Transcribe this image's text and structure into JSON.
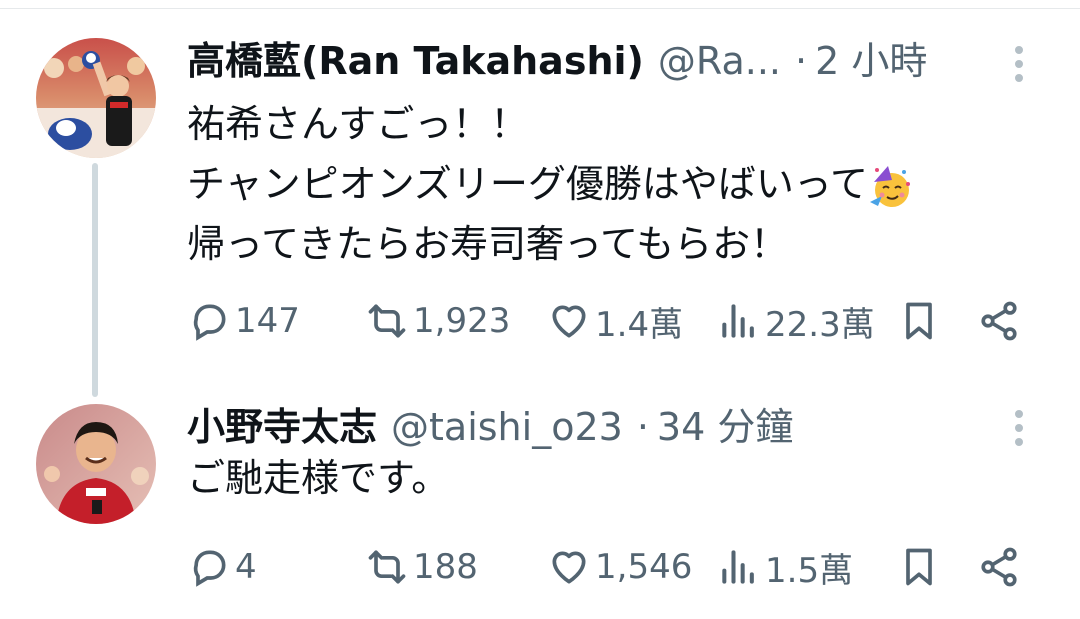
{
  "tweets": [
    {
      "name": "高橋藍(Ran Takahashi)",
      "handle": "@Ra...",
      "separator": "·",
      "time": "2 小時",
      "lines": [
        "祐希さんすごっ！！",
        "チャンピオンズリーグ優勝はやばいって",
        "帰ってきたらお寿司奢ってもらお！"
      ],
      "emoji": "partying-face",
      "replies": "147",
      "retweets": "1,923",
      "likes": "1.4萬",
      "views": "22.3萬"
    },
    {
      "name": "小野寺太志",
      "handle": "@taishi_o23",
      "separator": "·",
      "time": "34 分鐘",
      "lines": [
        "ご馳走様です。"
      ],
      "replies": "4",
      "retweets": "188",
      "likes": "1,546",
      "views": "1.5萬"
    }
  ],
  "icons": {
    "reply": "speech-bubble-icon",
    "retweet": "retweet-arrows-icon",
    "like": "heart-icon",
    "views": "bar-chart-icon",
    "bookmark": "bookmark-icon",
    "share": "share-icon",
    "more": "more-vertical-icon"
  },
  "colors": {
    "text": "#0f1419",
    "secondary": "#536471",
    "thread_line": "#cfd9de"
  }
}
